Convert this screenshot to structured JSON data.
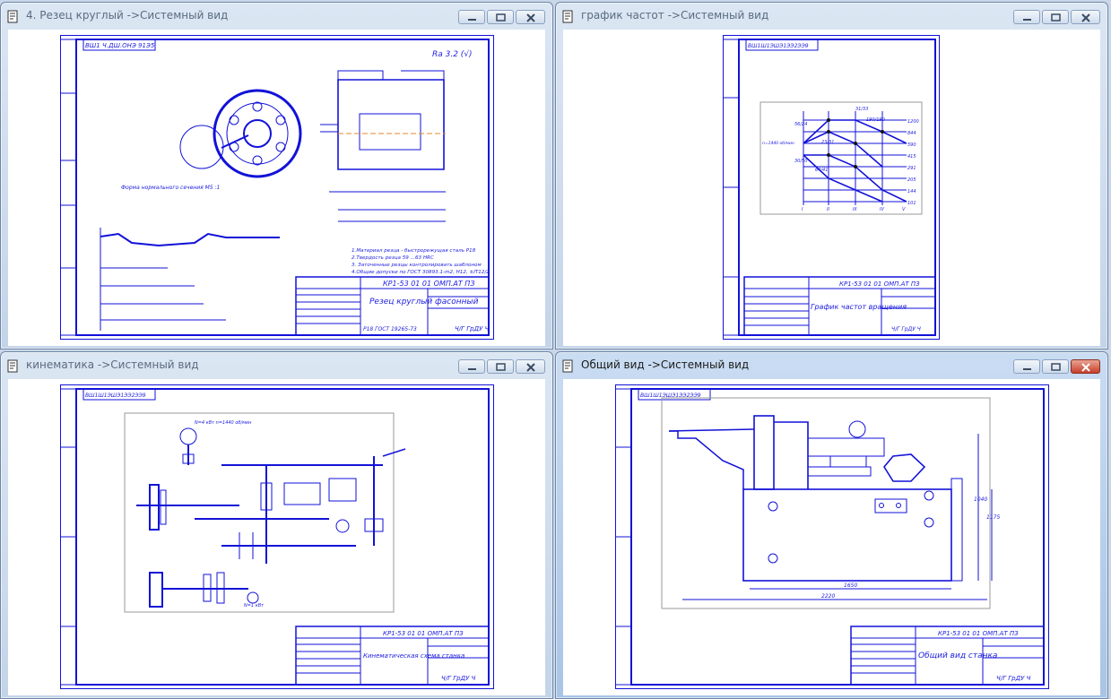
{
  "colors": {
    "drawing_line": "#1212d8",
    "paper": "#ffffff",
    "frame_border": "#6e86a6",
    "active_close": "#c6402a"
  },
  "windows": [
    {
      "title": "4. Резец круглый ->Системный вид",
      "active": false,
      "sheet": {
        "stamp_code": "КР1-53 01 01 ОМП.АТ ПЗ",
        "stamp_title": "Резец круглый фасонный",
        "stamp_material": "Р18 ГОСТ 19265-73",
        "stamp_org": "Ч/Г ГрДУ Ч",
        "roughness": "Ra 3.2 (√)",
        "corner_code": "ВШ1 Ч.ДШ.ОНЭ 91Э5",
        "section_label": "Форма нормального сечения М5 :1",
        "notes": [
          "1.Материал резца - быстрорежущая сталь Р18",
          "2.Твердость резца 59 ...63 HRC",
          "3. Заточенные резцы контролировать шаблоном",
          "4.Общие допуски по ГОСТ 30893.1-m2, H12, ±IT12/2"
        ]
      }
    },
    {
      "title": "график частот ->Системный вид",
      "active": false,
      "sheet": {
        "stamp_code": "КР1-53 01 01 ОМП.АТ ПЗ",
        "stamp_title": "График частот вращения",
        "stamp_org": "Ч/Г ГрДУ Ч",
        "corner_code": "ВШ1Ш1ЭШЭ1ЭЭ2ЭЭ9",
        "rpm_values": [
          "1200",
          "844",
          "590",
          "415",
          "291",
          "205",
          "144",
          "101"
        ],
        "annotations": [
          "31/33",
          "190/190",
          "56/24",
          "23/31",
          "30/50",
          "64/41",
          "n=1440 об/мин"
        ],
        "axis_ticks": [
          "I",
          "II",
          "III",
          "IV",
          "V"
        ]
      }
    },
    {
      "title": "кинематика ->Системный вид",
      "active": false,
      "sheet": {
        "stamp_code": "КР1-53 01 01 ОМП.АТ ПЗ",
        "stamp_title": "Кинематическая схема станка",
        "stamp_org": "Ч/Г ГрДУ Ч",
        "corner_code": "ВШ1Ш1ЭШЭ1ЭЭ2ЭЭ9",
        "motor_label": "N=4 кВт n=1440 об/мин",
        "motor2_label": "N=1 кВт"
      }
    },
    {
      "title": "Общий вид ->Системный вид",
      "active": true,
      "sheet": {
        "stamp_code": "КР1-53 01 01 ОМП.АТ ПЗ",
        "stamp_title": "Общий вид станка",
        "stamp_org": "Ч/Г ГрДУ Ч",
        "corner_code": "ВШ1Ш1ЭШЭ1ЭЭ2ЭЭ9",
        "dims": [
          "1650",
          "2220",
          "1040",
          "1175"
        ]
      }
    }
  ]
}
